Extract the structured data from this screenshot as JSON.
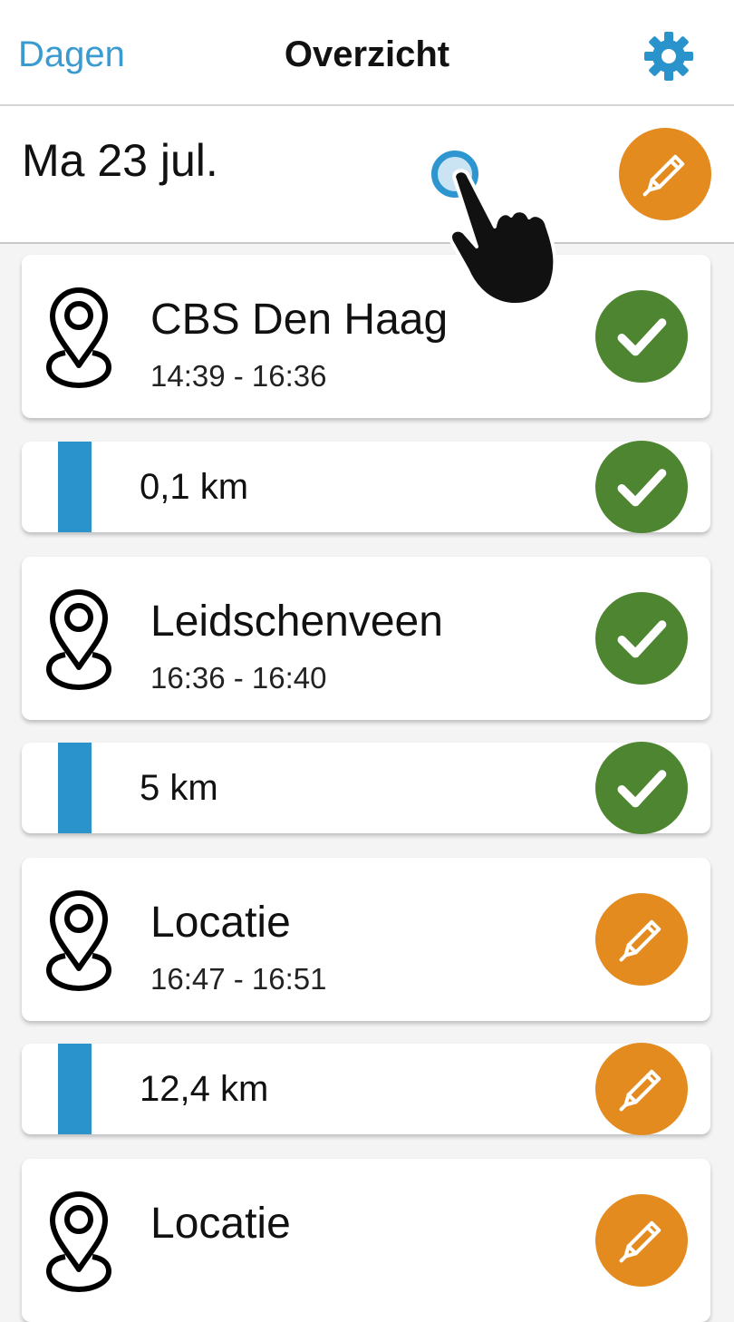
{
  "nav": {
    "back_label": "Dagen",
    "title": "Overzicht",
    "settings_icon": "gear-icon"
  },
  "day": {
    "date_label": "Ma 23 jul.",
    "edit_icon": "pencil-icon"
  },
  "colors": {
    "accent": "#3a9bd1",
    "confirmed": "#4e8530",
    "needs_edit": "#e38b1e",
    "trip_bar": "#2a93cc"
  },
  "timeline": [
    {
      "type": "location",
      "name": "CBS Den Haag",
      "time": "14:39 - 16:36",
      "status": "confirmed"
    },
    {
      "type": "trip",
      "distance": "0,1 km",
      "status": "confirmed"
    },
    {
      "type": "location",
      "name": "Leidschenveen",
      "time": "16:36 - 16:40",
      "status": "confirmed"
    },
    {
      "type": "trip",
      "distance": "5 km",
      "status": "confirmed"
    },
    {
      "type": "location",
      "name": "Locatie",
      "time": "16:47 - 16:51",
      "status": "edit"
    },
    {
      "type": "trip",
      "distance": "12,4 km",
      "status": "edit"
    },
    {
      "type": "location",
      "name": "Locatie",
      "time": "",
      "status": "edit"
    }
  ]
}
